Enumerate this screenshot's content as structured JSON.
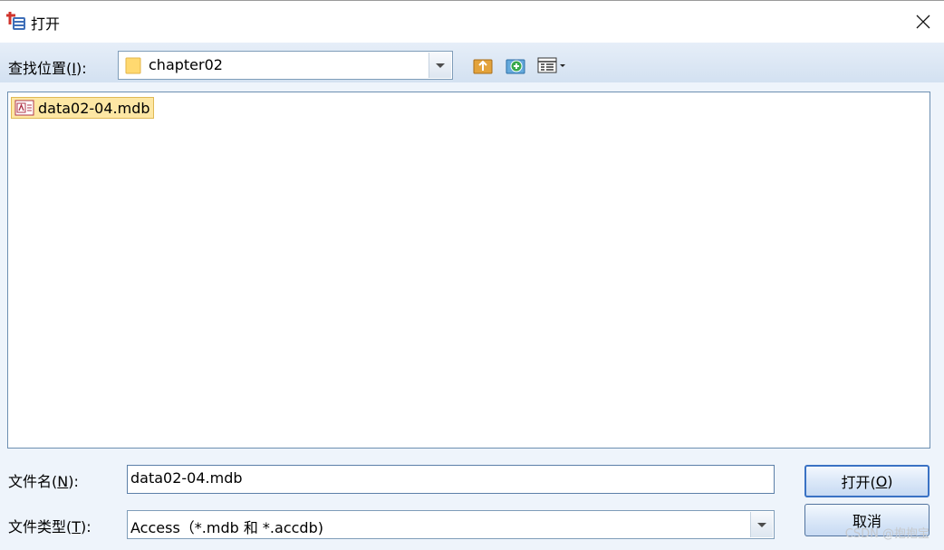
{
  "window": {
    "title": "打开"
  },
  "toolbar": {
    "look_in_label": "查找位置(",
    "look_in_key": "I",
    "look_in_suffix": "):",
    "folder_value": "chapter02"
  },
  "files": [
    {
      "name": "data02-04.mdb"
    }
  ],
  "filename_row": {
    "label": "文件名(",
    "key": "N",
    "suffix": "):",
    "value": "data02-04.mdb"
  },
  "filetype_row": {
    "label": "文件类型(",
    "key": "T",
    "suffix": "):",
    "value": "Access（*.mdb 和 *.accdb)"
  },
  "buttons": {
    "open_label": "打开(",
    "open_key": "O",
    "open_suffix": ")",
    "cancel_label": "取消"
  },
  "watermark": "CSDN @抱抱宝"
}
